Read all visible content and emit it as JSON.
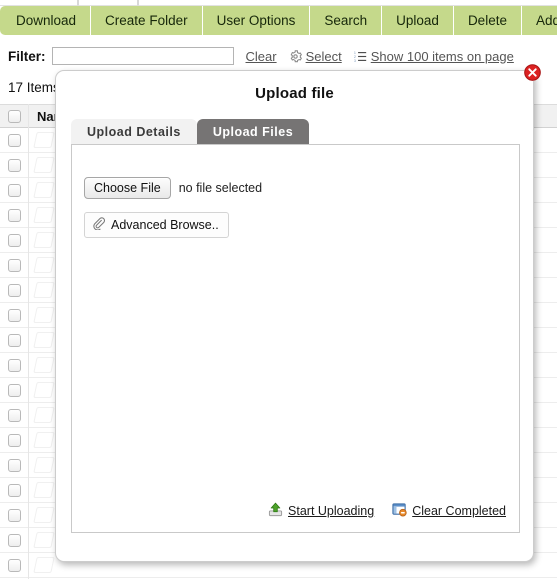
{
  "toolbar": {
    "items": [
      {
        "label": "Download",
        "name": "download"
      },
      {
        "label": "Create Folder",
        "name": "create-folder"
      },
      {
        "label": "User Options",
        "name": "user-options"
      },
      {
        "label": "Search",
        "name": "search"
      },
      {
        "label": "Upload",
        "name": "upload"
      },
      {
        "label": "Delete",
        "name": "delete"
      },
      {
        "label": "Add To Basket",
        "name": "add-to-basket"
      }
    ],
    "accent_color": "#c5d98b"
  },
  "filter_bar": {
    "label": "Filter:",
    "input_value": "",
    "input_placeholder": "",
    "clear_label": "Clear",
    "select_label": "Select",
    "show_items_label": "Show 100 items on page"
  },
  "list": {
    "item_count_text": "17 Items",
    "columns": [
      "Name"
    ],
    "row_count": 18
  },
  "dialog": {
    "title": "Upload file",
    "close_label": "×",
    "tabs": [
      {
        "label": "Upload Details",
        "active": false
      },
      {
        "label": "Upload Files",
        "active": true
      }
    ],
    "choose_file_button": "Choose File",
    "no_file_text": "no file selected",
    "advanced_browse_button": "Advanced Browse..",
    "start_uploading_label": "Start Uploading",
    "clear_completed_label": "Clear Completed"
  },
  "colors": {
    "toolbar_green": "#c5d98b",
    "active_tab_gray": "#767474",
    "close_red": "#e02424",
    "upload_green": "#4ea32a",
    "clear_blue": "#5b8fc9",
    "badge_orange": "#e8892a"
  }
}
